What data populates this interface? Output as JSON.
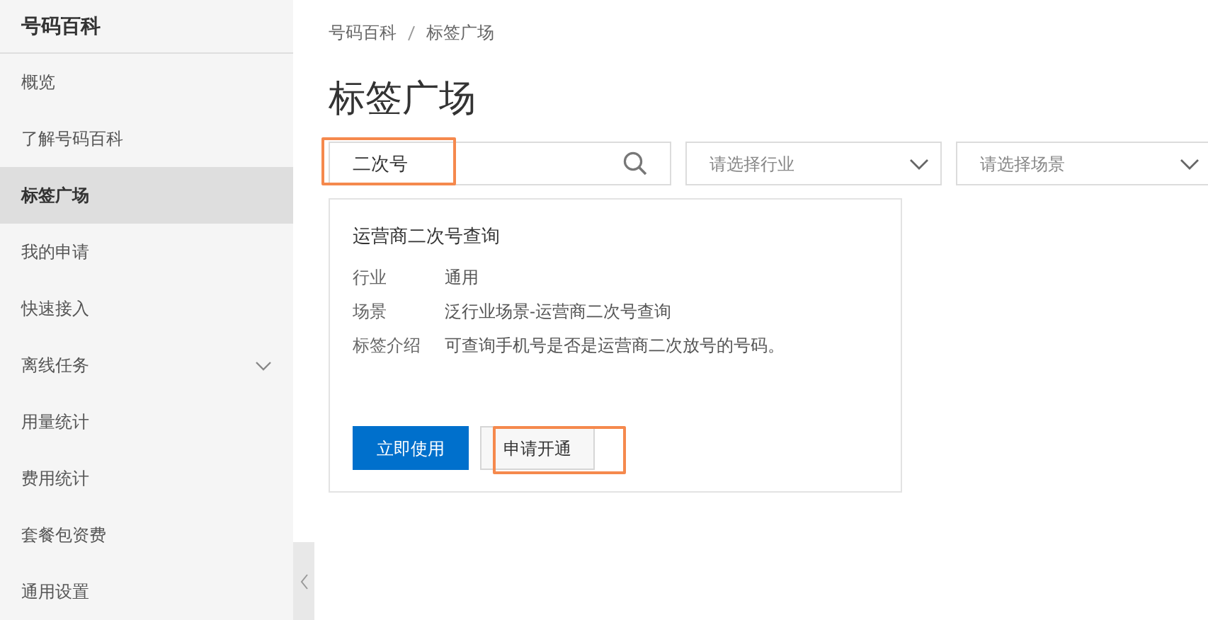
{
  "sidebar": {
    "title": "号码百科",
    "items": [
      {
        "label": "概览",
        "selected": false,
        "kind": "link"
      },
      {
        "label": "了解号码百科",
        "selected": false,
        "kind": "link"
      },
      {
        "label": "标签广场",
        "selected": true,
        "kind": "link"
      },
      {
        "label": "我的申请",
        "selected": false,
        "kind": "link"
      },
      {
        "label": "快速接入",
        "selected": false,
        "kind": "link"
      },
      {
        "label": "离线任务",
        "selected": false,
        "kind": "submenu"
      },
      {
        "label": "用量统计",
        "selected": false,
        "kind": "link"
      },
      {
        "label": "费用统计",
        "selected": false,
        "kind": "link"
      },
      {
        "label": "套餐包资费",
        "selected": false,
        "kind": "link"
      },
      {
        "label": "通用设置",
        "selected": false,
        "kind": "link"
      }
    ]
  },
  "breadcrumb": [
    "号码百科",
    "标签广场"
  ],
  "page_title": "标签广场",
  "filters": [
    {
      "kind": "search",
      "value": "二次号",
      "highlighted": true
    },
    {
      "kind": "select",
      "placeholder": "请选择行业",
      "highlighted": false
    },
    {
      "kind": "select",
      "placeholder": "请选择场景",
      "highlighted": false
    }
  ],
  "card": {
    "title": "运营商二次号查询",
    "fields": [
      {
        "label": "行业",
        "value": "通用"
      },
      {
        "label": "场景",
        "value": "泛行业场景-运营商二次号查询"
      },
      {
        "label": "标签介绍",
        "value": "可查询手机号是否是运营商二次放号的号码。"
      }
    ],
    "buttons": [
      {
        "label": "立即使用",
        "kind": "primary",
        "highlighted": false
      },
      {
        "label": "申请开通",
        "kind": "secondary",
        "highlighted": true
      }
    ]
  }
}
